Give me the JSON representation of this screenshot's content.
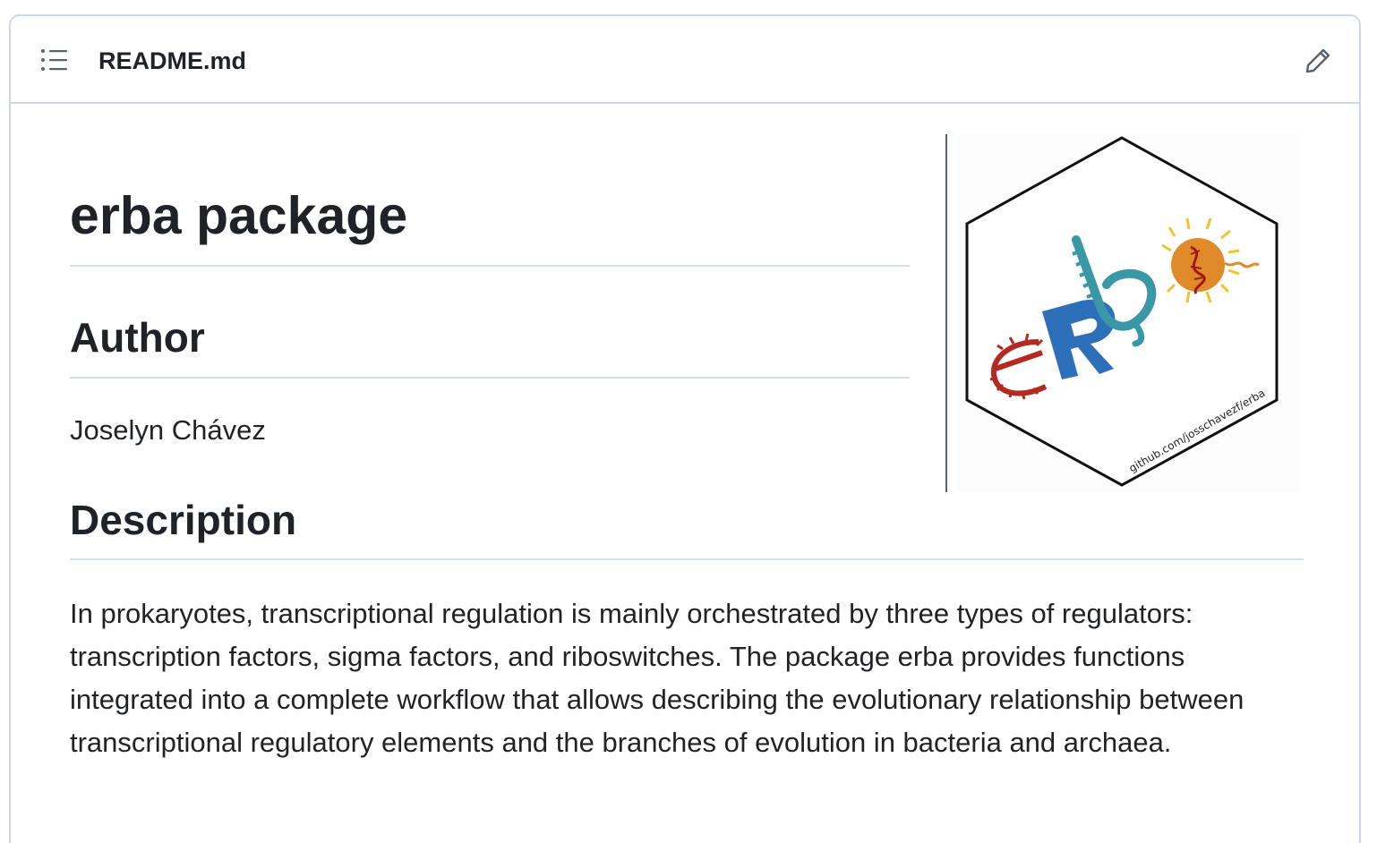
{
  "file": {
    "name": "README.md"
  },
  "icons": {
    "toc": "list-unordered-icon",
    "edit": "pencil-icon"
  },
  "readme": {
    "title": "erba package",
    "author_heading": "Author",
    "author_name": "Joselyn Chávez",
    "description_heading": "Description",
    "description": "In prokaryotes, transcriptional regulation is mainly orchestrated by three types of regulators: transcription factors, sigma factors, and riboswitches. The package erba provides functions integrated into a complete workflow that allows describing the evolutionary relationship between transcriptional regulatory elements and the branches of evolution in bacteria and archaea."
  },
  "logo": {
    "url_text": "github.com/josschavezf/erba",
    "colors": {
      "e": "#b22a22",
      "R": "#2e6fba",
      "b": "#3a98a6",
      "a": "#e08a2a",
      "sun": "#f2c230"
    }
  },
  "colors": {
    "text": "#1f2328",
    "border": "#d0d7de",
    "muted": "#59636e"
  }
}
